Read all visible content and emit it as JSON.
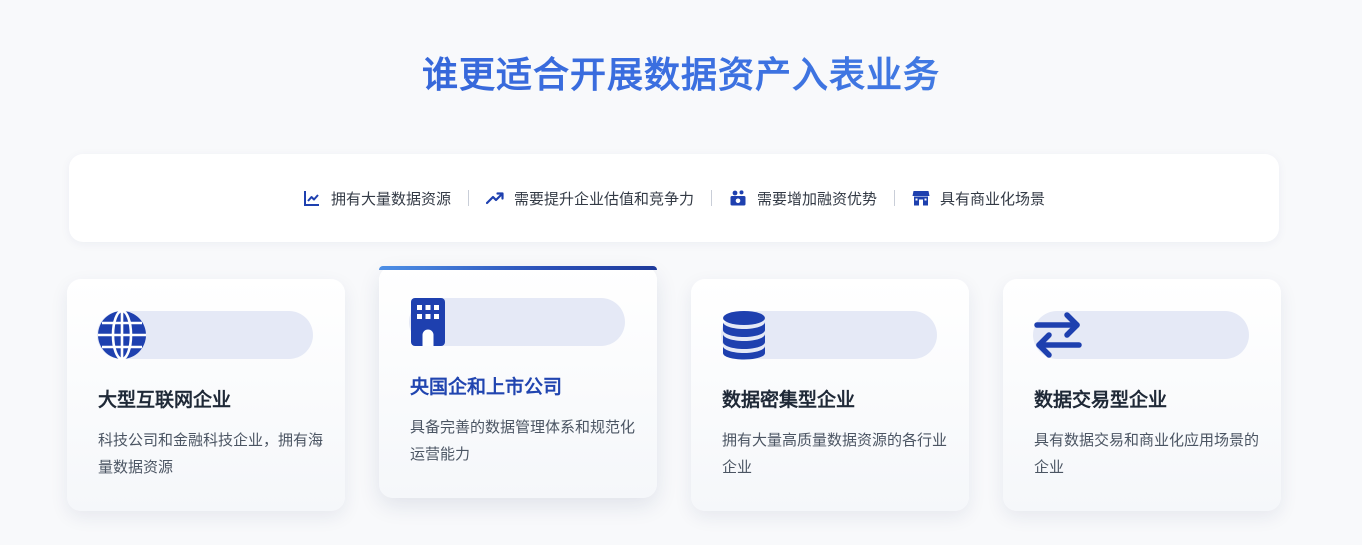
{
  "title": "谁更适合开展数据资产入表业务",
  "criteria": [
    {
      "label": "拥有大量数据资源",
      "icon": "line-chart-icon"
    },
    {
      "label": "需要提升企业估值和竞争力",
      "icon": "trending-up-icon"
    },
    {
      "label": "需要增加融资优势",
      "icon": "financing-icon"
    },
    {
      "label": "具有商业化场景",
      "icon": "storefront-icon"
    }
  ],
  "cards": [
    {
      "title": "大型互联网企业",
      "desc": "科技公司和金融科技企业，拥有海量数据资源",
      "icon": "globe-icon"
    },
    {
      "title": "央国企和上市公司",
      "desc": "具备完善的数据管理体系和规范化运营能力",
      "icon": "building-icon",
      "active": true
    },
    {
      "title": "数据密集型企业",
      "desc": "拥有大量高质量数据资源的各行业企业",
      "icon": "database-icon"
    },
    {
      "title": "数据交易型企业",
      "desc": "具有数据交易和商业化应用场景的企业",
      "icon": "exchange-arrows-icon"
    }
  ],
  "colors": {
    "accent": "#1e40af",
    "title_gradient": [
      "#2f5bd0",
      "#4b8ae6"
    ],
    "pill": "#e5e9f6"
  }
}
